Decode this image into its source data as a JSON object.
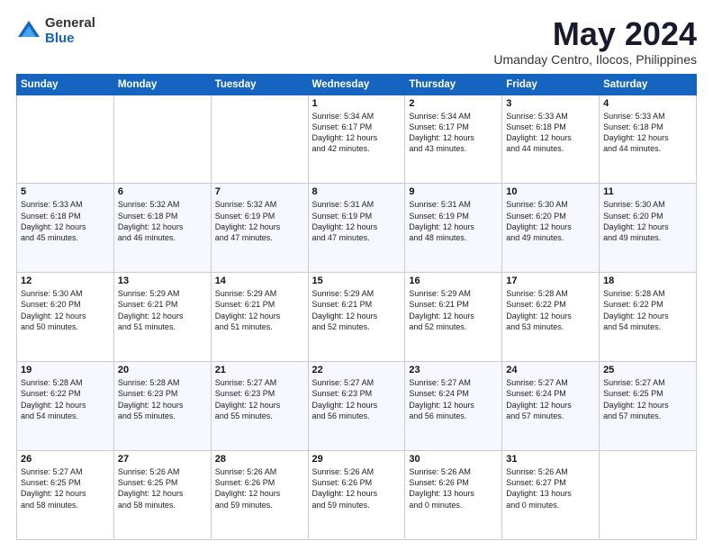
{
  "logo": {
    "general": "General",
    "blue": "Blue"
  },
  "title": "May 2024",
  "location": "Umanday Centro, Ilocos, Philippines",
  "days": [
    "Sunday",
    "Monday",
    "Tuesday",
    "Wednesday",
    "Thursday",
    "Friday",
    "Saturday"
  ],
  "weeks": [
    [
      {
        "day": "",
        "info": ""
      },
      {
        "day": "",
        "info": ""
      },
      {
        "day": "",
        "info": ""
      },
      {
        "day": "1",
        "info": "Sunrise: 5:34 AM\nSunset: 6:17 PM\nDaylight: 12 hours\nand 42 minutes."
      },
      {
        "day": "2",
        "info": "Sunrise: 5:34 AM\nSunset: 6:17 PM\nDaylight: 12 hours\nand 43 minutes."
      },
      {
        "day": "3",
        "info": "Sunrise: 5:33 AM\nSunset: 6:18 PM\nDaylight: 12 hours\nand 44 minutes."
      },
      {
        "day": "4",
        "info": "Sunrise: 5:33 AM\nSunset: 6:18 PM\nDaylight: 12 hours\nand 44 minutes."
      }
    ],
    [
      {
        "day": "5",
        "info": "Sunrise: 5:33 AM\nSunset: 6:18 PM\nDaylight: 12 hours\nand 45 minutes."
      },
      {
        "day": "6",
        "info": "Sunrise: 5:32 AM\nSunset: 6:18 PM\nDaylight: 12 hours\nand 46 minutes."
      },
      {
        "day": "7",
        "info": "Sunrise: 5:32 AM\nSunset: 6:19 PM\nDaylight: 12 hours\nand 47 minutes."
      },
      {
        "day": "8",
        "info": "Sunrise: 5:31 AM\nSunset: 6:19 PM\nDaylight: 12 hours\nand 47 minutes."
      },
      {
        "day": "9",
        "info": "Sunrise: 5:31 AM\nSunset: 6:19 PM\nDaylight: 12 hours\nand 48 minutes."
      },
      {
        "day": "10",
        "info": "Sunrise: 5:30 AM\nSunset: 6:20 PM\nDaylight: 12 hours\nand 49 minutes."
      },
      {
        "day": "11",
        "info": "Sunrise: 5:30 AM\nSunset: 6:20 PM\nDaylight: 12 hours\nand 49 minutes."
      }
    ],
    [
      {
        "day": "12",
        "info": "Sunrise: 5:30 AM\nSunset: 6:20 PM\nDaylight: 12 hours\nand 50 minutes."
      },
      {
        "day": "13",
        "info": "Sunrise: 5:29 AM\nSunset: 6:21 PM\nDaylight: 12 hours\nand 51 minutes."
      },
      {
        "day": "14",
        "info": "Sunrise: 5:29 AM\nSunset: 6:21 PM\nDaylight: 12 hours\nand 51 minutes."
      },
      {
        "day": "15",
        "info": "Sunrise: 5:29 AM\nSunset: 6:21 PM\nDaylight: 12 hours\nand 52 minutes."
      },
      {
        "day": "16",
        "info": "Sunrise: 5:29 AM\nSunset: 6:21 PM\nDaylight: 12 hours\nand 52 minutes."
      },
      {
        "day": "17",
        "info": "Sunrise: 5:28 AM\nSunset: 6:22 PM\nDaylight: 12 hours\nand 53 minutes."
      },
      {
        "day": "18",
        "info": "Sunrise: 5:28 AM\nSunset: 6:22 PM\nDaylight: 12 hours\nand 54 minutes."
      }
    ],
    [
      {
        "day": "19",
        "info": "Sunrise: 5:28 AM\nSunset: 6:22 PM\nDaylight: 12 hours\nand 54 minutes."
      },
      {
        "day": "20",
        "info": "Sunrise: 5:28 AM\nSunset: 6:23 PM\nDaylight: 12 hours\nand 55 minutes."
      },
      {
        "day": "21",
        "info": "Sunrise: 5:27 AM\nSunset: 6:23 PM\nDaylight: 12 hours\nand 55 minutes."
      },
      {
        "day": "22",
        "info": "Sunrise: 5:27 AM\nSunset: 6:23 PM\nDaylight: 12 hours\nand 56 minutes."
      },
      {
        "day": "23",
        "info": "Sunrise: 5:27 AM\nSunset: 6:24 PM\nDaylight: 12 hours\nand 56 minutes."
      },
      {
        "day": "24",
        "info": "Sunrise: 5:27 AM\nSunset: 6:24 PM\nDaylight: 12 hours\nand 57 minutes."
      },
      {
        "day": "25",
        "info": "Sunrise: 5:27 AM\nSunset: 6:25 PM\nDaylight: 12 hours\nand 57 minutes."
      }
    ],
    [
      {
        "day": "26",
        "info": "Sunrise: 5:27 AM\nSunset: 6:25 PM\nDaylight: 12 hours\nand 58 minutes."
      },
      {
        "day": "27",
        "info": "Sunrise: 5:26 AM\nSunset: 6:25 PM\nDaylight: 12 hours\nand 58 minutes."
      },
      {
        "day": "28",
        "info": "Sunrise: 5:26 AM\nSunset: 6:26 PM\nDaylight: 12 hours\nand 59 minutes."
      },
      {
        "day": "29",
        "info": "Sunrise: 5:26 AM\nSunset: 6:26 PM\nDaylight: 12 hours\nand 59 minutes."
      },
      {
        "day": "30",
        "info": "Sunrise: 5:26 AM\nSunset: 6:26 PM\nDaylight: 13 hours\nand 0 minutes."
      },
      {
        "day": "31",
        "info": "Sunrise: 5:26 AM\nSunset: 6:27 PM\nDaylight: 13 hours\nand 0 minutes."
      },
      {
        "day": "",
        "info": ""
      }
    ]
  ]
}
